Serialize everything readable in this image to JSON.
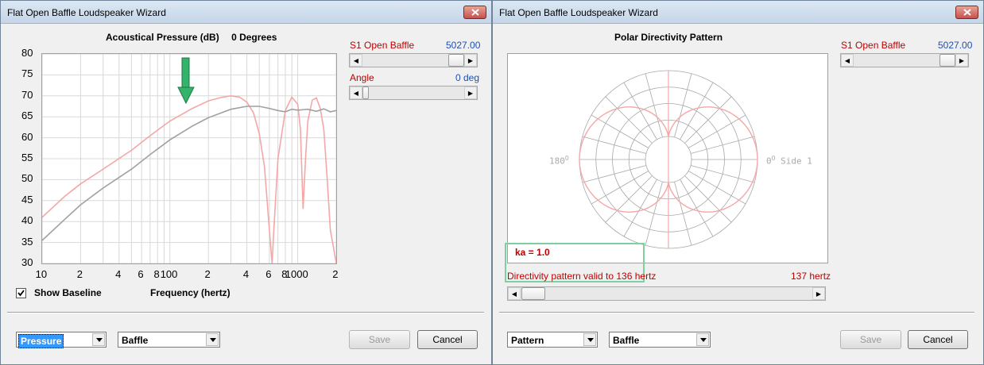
{
  "left_window": {
    "title": "Flat Open Baffle Loudspeaker Wizard",
    "chart_title": "Acoustical Pressure (dB)",
    "chart_angle": "0 Degrees",
    "s1_label": "S1  Open Baffle",
    "s1_value": "5027.00",
    "angle_label": "Angle",
    "angle_value": "0 deg",
    "show_baseline_label": "Show Baseline",
    "show_baseline_checked": true,
    "xaxis_title": "Frequency (hertz)",
    "combo1_value": "Pressure",
    "combo2_value": "Baffle",
    "save_label": "Save",
    "cancel_label": "Cancel"
  },
  "right_window": {
    "title": "Flat Open Baffle Loudspeaker Wizard",
    "chart_title": "Polar Directivity Pattern",
    "s1_label": "S1  Open Baffle",
    "s1_value": "5027.00",
    "label_180": "180",
    "label_0": "0",
    "label_side": "Side 1",
    "ka_label": "ka = 1.0",
    "validity_text": "Directivity pattern valid to 136 hertz",
    "freq_value": "137 hertz",
    "combo1_value": "Pattern",
    "combo2_value": "Baffle",
    "save_label": "Save",
    "cancel_label": "Cancel"
  },
  "colors": {
    "response": "#f4a7a7",
    "baseline": "#a0a0a0",
    "label_red": "#c00000",
    "value_blue": "#1f4fb0",
    "arrow": "#34b36a",
    "highlight_box": "#7fd0a0"
  },
  "chart_data": [
    {
      "type": "line",
      "xscale": "log",
      "xlim": [
        10,
        2000
      ],
      "ylim": [
        30,
        80
      ],
      "y_ticks": [
        "80",
        "75",
        "70",
        "65",
        "60",
        "55",
        "50",
        "45",
        "40",
        "35",
        "30"
      ],
      "x_tick_labels": [
        "10",
        "2",
        "4",
        "6",
        "8",
        "100",
        "2",
        "4",
        "6",
        "8",
        "1000",
        "2"
      ],
      "series": [
        {
          "x": [
            10,
            15,
            20,
            30,
            50,
            70,
            100,
            150,
            200,
            250,
            300,
            350,
            400,
            450,
            500,
            550,
            600,
            630,
            650,
            700,
            800,
            900,
            1000,
            1050,
            1100,
            1150,
            1200,
            1300,
            1400,
            1500,
            1600,
            1700,
            1800,
            1900,
            2000
          ],
          "y": [
            41,
            46,
            49,
            52.5,
            57,
            60.5,
            64,
            67,
            68.8,
            69.6,
            70,
            69.7,
            68.5,
            66,
            61,
            53,
            38,
            30,
            38,
            55,
            66.5,
            69.7,
            68,
            62,
            43,
            55,
            64,
            69,
            69.5,
            67,
            62,
            50,
            38,
            34,
            30
          ]
        },
        {
          "x": [
            10,
            15,
            20,
            30,
            50,
            70,
            100,
            150,
            200,
            300,
            400,
            500,
            600,
            700,
            800,
            900,
            1000,
            1200,
            1400,
            1600,
            1800,
            2000
          ],
          "y": [
            35.5,
            40.5,
            44,
            48,
            52.5,
            56,
            59.5,
            62.8,
            64.8,
            66.8,
            67.5,
            67.5,
            67,
            66.5,
            66.2,
            66.8,
            66.6,
            66.8,
            66.3,
            66.9,
            66.2,
            66.5
          ]
        }
      ]
    },
    {
      "type": "polar",
      "pattern": "dipole figure-8",
      "rings": 5,
      "spokes": 24
    }
  ]
}
